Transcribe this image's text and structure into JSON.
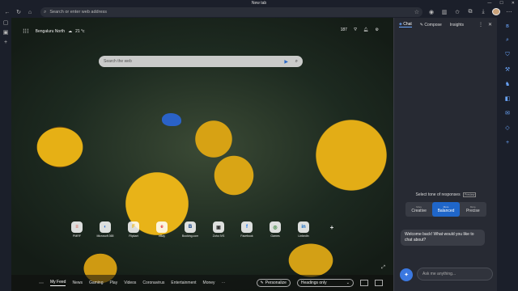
{
  "window": {
    "title": "New tab",
    "controls": [
      "—",
      "☐",
      "✕"
    ]
  },
  "toolbar": {
    "address_placeholder": "Search or enter web address",
    "back_icon": "back-icon",
    "refresh_icon": "refresh-icon",
    "home_icon": "home-icon"
  },
  "newtab": {
    "location": "Bengaluru North",
    "temperature": "21 °c",
    "counter": "187",
    "search_placeholder": "Search the web"
  },
  "shortcuts": [
    {
      "label": "PMRF",
      "glyph": "≡",
      "color": "#d84a3a"
    },
    {
      "label": "Microsoft 365",
      "glyph": "◐",
      "color": "#2b6fd6"
    },
    {
      "label": "Flipkart",
      "glyph": "F",
      "color": "#f4b400"
    },
    {
      "label": "eBay",
      "glyph": "e",
      "color": "#e53238"
    },
    {
      "label": "Booking.com",
      "glyph": "B",
      "color": "#003580"
    },
    {
      "label": "Zoho IVS",
      "glyph": "▣",
      "color": "#333"
    },
    {
      "label": "Facebook",
      "glyph": "f",
      "color": "#1877f2"
    },
    {
      "label": "Games",
      "glyph": "◎",
      "color": "#2e7d32"
    },
    {
      "label": "LinkedIn",
      "glyph": "in",
      "color": "#0a66c2"
    },
    {
      "label": "",
      "glyph": "+",
      "color": "#eee"
    }
  ],
  "feed": {
    "tabs": [
      "My Feed",
      "News",
      "Gaming",
      "Play",
      "Videos",
      "Coronavirus",
      "Entertainment",
      "Money"
    ],
    "more": "⋯",
    "personalize": "Personalize",
    "headings_select": "Headings only"
  },
  "chat": {
    "tabs": [
      "Chat",
      "Compose",
      "Insights"
    ],
    "tone_title": "Select tone of responses",
    "preview": "Preview",
    "tones": [
      {
        "small": "More",
        "label": "Creative"
      },
      {
        "small": "More",
        "label": "Balanced"
      },
      {
        "small": "More",
        "label": "Precise"
      }
    ],
    "selected_tone": "Balanced",
    "welcome": "Welcome back! What would you like to chat about?",
    "ask_placeholder": "Ask me anything..."
  }
}
